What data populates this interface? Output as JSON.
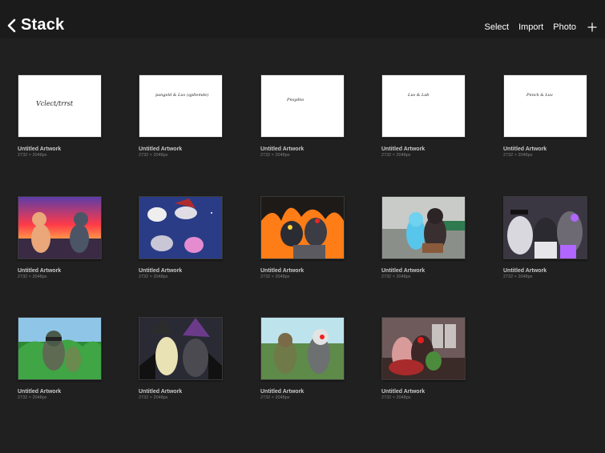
{
  "header": {
    "title": "Stack",
    "select_label": "Select",
    "import_label": "Import",
    "photo_label": "Photo"
  },
  "artworks": [
    {
      "name": "Untitled Artwork",
      "dims": "2732 × 2048px",
      "sketch": "Vclect/trrst"
    },
    {
      "name": "Untitled Artwork",
      "dims": "2732 × 2048px",
      "sketch": "pangeld & Luv (qpllemde)"
    },
    {
      "name": "Untitled Artwork",
      "dims": "2732 × 2048px",
      "sketch": "Pnsydno"
    },
    {
      "name": "Untitled Artwork",
      "dims": "2732 × 2048px",
      "sketch": "Luv & Lab"
    },
    {
      "name": "Untitled Artwork",
      "dims": "2732 × 2048px",
      "sketch": "Pnnch & Luv"
    },
    {
      "name": "Untitled Artwork",
      "dims": "2732 × 2048px"
    },
    {
      "name": "Untitled Artwork",
      "dims": "2732 × 2048px"
    },
    {
      "name": "Untitled Artwork",
      "dims": "2732 × 2048px"
    },
    {
      "name": "Untitled Artwork",
      "dims": "2732 × 2048px"
    },
    {
      "name": "Untitled Artwork",
      "dims": "2732 × 2048px"
    },
    {
      "name": "Untitled Artwork",
      "dims": "2732 × 2048px"
    },
    {
      "name": "Untitled Artwork",
      "dims": "2732 × 2048px"
    },
    {
      "name": "Untitled Artwork",
      "dims": "2732 × 2048px"
    },
    {
      "name": "Untitled Artwork",
      "dims": "2732 × 2048px"
    }
  ]
}
